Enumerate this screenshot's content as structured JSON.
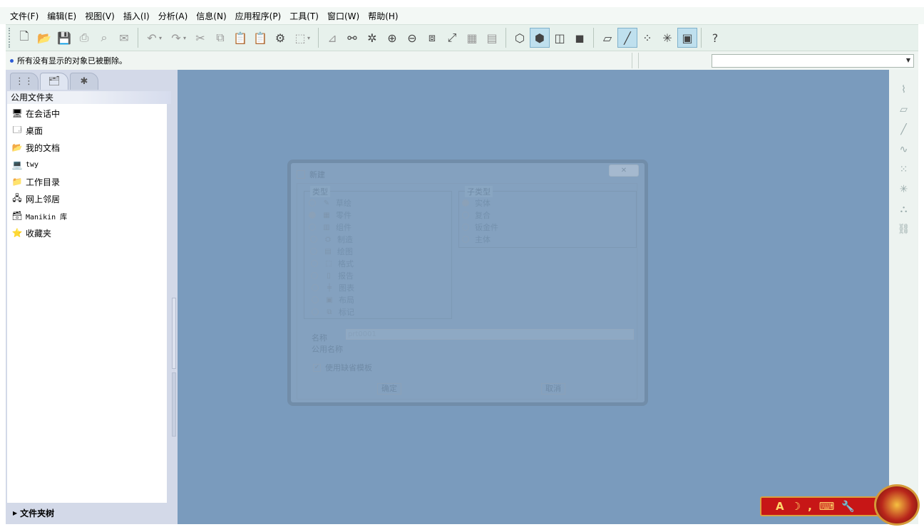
{
  "menubar": {
    "items": [
      "文件(F)",
      "编辑(E)",
      "视图(V)",
      "插入(I)",
      "分析(A)",
      "信息(N)",
      "应用程序(P)",
      "工具(T)",
      "窗口(W)",
      "帮助(H)"
    ]
  },
  "toolbar": {
    "help_label": "?"
  },
  "message_bar": {
    "text": "所有没有显示的对象已被删除。",
    "accent_color": "#2d5bd6"
  },
  "navigator": {
    "header": "公用文件夹",
    "items": [
      {
        "label": "在会话中",
        "icon": "session-icon"
      },
      {
        "label": "桌面",
        "icon": "desktop-icon"
      },
      {
        "label": "我的文档",
        "icon": "documents-icon"
      },
      {
        "label": "twy",
        "icon": "computer-icon"
      },
      {
        "label": "工作目录",
        "icon": "working-dir-icon"
      },
      {
        "label": "网上邻居",
        "icon": "network-icon"
      },
      {
        "label": "Manikin 库",
        "icon": "library-icon"
      },
      {
        "label": "收藏夹",
        "icon": "favorites-icon"
      }
    ],
    "footer": "文件夹树"
  },
  "dialog": {
    "title": "新建",
    "close": "✕",
    "type_group_title": "类型",
    "types": [
      "草绘",
      "零件",
      "组件",
      "制造",
      "绘图",
      "格式",
      "报告",
      "图表",
      "布局",
      "标记"
    ],
    "subtype_group_title": "子类型",
    "subtypes": [
      "实体",
      "复合",
      "钣金件",
      "主体"
    ],
    "name_label": "名称",
    "name_value": "prt0001",
    "common_name_label": "公用名称",
    "template_checkbox": "使用缺省模板",
    "ok": "确定",
    "cancel": "取消"
  },
  "colors": {
    "graphics_bg": "#7a9bbd",
    "ime_red": "#c71616"
  }
}
